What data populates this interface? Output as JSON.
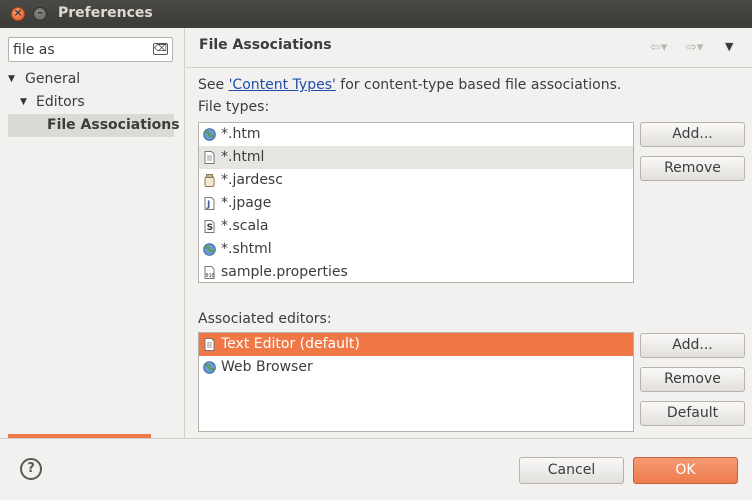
{
  "window": {
    "title": "Preferences"
  },
  "sidebar": {
    "filter_value": "file as",
    "tree": [
      {
        "label": "General",
        "level": 0,
        "expanded": true
      },
      {
        "label": "Editors",
        "level": 1,
        "expanded": true
      },
      {
        "label": "File Associations",
        "level": 2,
        "selected": true
      }
    ]
  },
  "page": {
    "title": "File Associations",
    "intro_prefix": "See ",
    "intro_link": "'Content Types'",
    "intro_suffix": " for content-type based file associations.",
    "file_types_label": "File types:",
    "file_types": [
      {
        "name": "*.htm",
        "icon": "globe-icon"
      },
      {
        "name": "*.html",
        "icon": "document-icon",
        "selected": true
      },
      {
        "name": "*.jardesc",
        "icon": "jar-icon"
      },
      {
        "name": "*.jpage",
        "icon": "java-scrapbook-icon"
      },
      {
        "name": "*.scala",
        "icon": "scala-file-icon"
      },
      {
        "name": "*.shtml",
        "icon": "globe-icon"
      },
      {
        "name": "sample.properties",
        "icon": "properties-file-icon"
      }
    ],
    "file_types_buttons": {
      "add": "Add...",
      "remove": "Remove"
    },
    "editors_label": "Associated editors:",
    "editors": [
      {
        "name": "Text Editor (default)",
        "icon": "document-icon",
        "selected": true
      },
      {
        "name": "Web Browser",
        "icon": "globe-icon"
      }
    ],
    "editors_buttons": {
      "add": "Add...",
      "remove": "Remove",
      "default": "Default"
    }
  },
  "footer": {
    "help": "?",
    "cancel": "Cancel",
    "ok": "OK"
  },
  "colors": {
    "accent": "#f07746",
    "titlebar": "#3c3b37",
    "link": "#1f4fa8"
  }
}
